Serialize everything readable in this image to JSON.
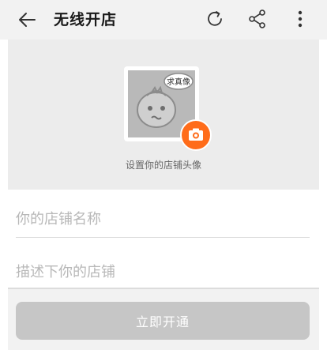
{
  "app_bar": {
    "title": "无线开店",
    "icons": [
      "back-arrow-icon",
      "refresh-icon",
      "share-icon",
      "more-vertical-icon"
    ]
  },
  "avatar": {
    "bubble_text": "求真像",
    "caption": "设置你的店铺头像",
    "badge_icon": "camera-icon"
  },
  "form": {
    "store_name_placeholder": "你的店铺名称",
    "store_description_placeholder": "描述下你的店铺",
    "submit_label": "立即开通"
  },
  "colors": {
    "accent_orange": "#ff6c1a",
    "disabled_button": "#c6c6c6",
    "section_grey": "#ececec"
  }
}
